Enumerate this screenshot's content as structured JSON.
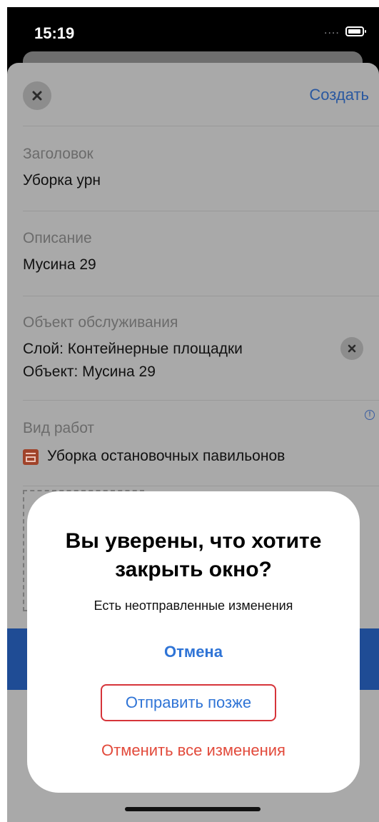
{
  "status_bar": {
    "time": "15:19",
    "signal": "....",
    "battery_icon": "battery-icon"
  },
  "header": {
    "close_icon": "close-icon",
    "create_label": "Создать"
  },
  "fields": {
    "title": {
      "label": "Заголовок",
      "value": "Уборка урн"
    },
    "description": {
      "label": "Описание",
      "value": "Мусина 29"
    },
    "service_object": {
      "label": "Объект обслуживания",
      "line1": "Слой: Контейнерные площадки",
      "line2": "Объект: Мусина 29",
      "clear_icon": "close-icon"
    },
    "work_type": {
      "label": "Вид работ",
      "value": "Уборка остановочных павильонов",
      "icon": "work-type-icon",
      "info_icon": "info-icon"
    }
  },
  "dialog": {
    "title": "Вы уверены, что хотите закрыть окно?",
    "message": "Есть неотправленные изменения",
    "cancel_label": "Отмена",
    "send_later_label": "Отправить позже",
    "discard_label": "Отменить все изменения"
  },
  "colors": {
    "accent_blue": "#2f74d6",
    "destructive_red": "#e24a3b",
    "highlight_border": "#d6343a",
    "dim_overlay": "#a9a9a9"
  }
}
